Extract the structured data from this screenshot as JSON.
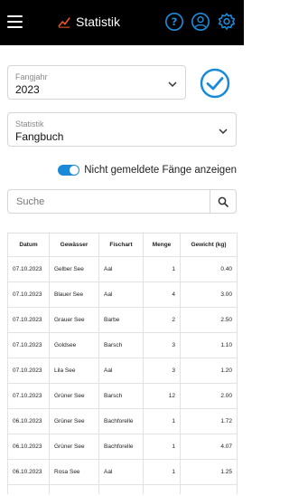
{
  "header": {
    "title": "Statistik",
    "icons": [
      "menu-icon",
      "chart-icon",
      "help-icon",
      "account-icon",
      "settings-icon"
    ],
    "accent_color": "#1a8ad8"
  },
  "fangjahr": {
    "label": "Fangjahr",
    "value": "2023"
  },
  "statistik": {
    "label": "Statistik",
    "value": "Fangbuch"
  },
  "toggle": {
    "label": "Nicht gemeldete Fänge anzeigen",
    "on": true
  },
  "search": {
    "placeholder": "Suche"
  },
  "table": {
    "headers": [
      "Datum",
      "Gewässer",
      "Fischart",
      "Menge",
      "Gewicht (kg)"
    ],
    "rows": [
      [
        "07.10.2023",
        "Gelber See",
        "Aal",
        "1",
        "0.40"
      ],
      [
        "07.10.2023",
        "Blauer See",
        "Aal",
        "4",
        "3.00"
      ],
      [
        "07.10.2023",
        "Grauer See",
        "Barbe",
        "2",
        "2.50"
      ],
      [
        "07.10.2023",
        "Goldsee",
        "Barsch",
        "3",
        "1.10"
      ],
      [
        "07.10.2023",
        "Lila See",
        "Aal",
        "3",
        "1.20"
      ],
      [
        "07.10.2023",
        "Grüner See",
        "Barsch",
        "12",
        "2.00"
      ],
      [
        "06.10.2023",
        "Grüner See",
        "Bachforelle",
        "1",
        "1.72"
      ],
      [
        "06.10.2023",
        "Grüner See",
        "Bachforelle",
        "1",
        "4.07"
      ],
      [
        "06.10.2023",
        "Rosa See",
        "Aal",
        "1",
        "1.25"
      ]
    ]
  }
}
